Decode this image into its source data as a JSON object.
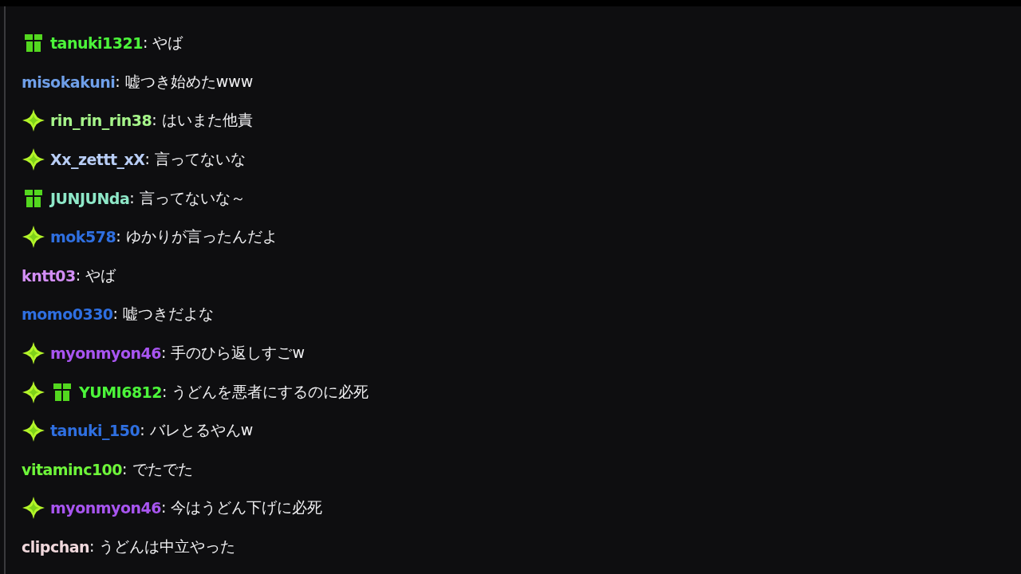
{
  "messages": [
    {
      "badges": [
        {
          "kind": "gift"
        }
      ],
      "user": "tanuki1321",
      "color": "#4cf53a",
      "text": ": やば"
    },
    {
      "user": "misokakuni",
      "color": "#6f9fe8",
      "text": ": 嘘つき始めたwww"
    },
    {
      "badges": [
        {
          "kind": "sparkle"
        }
      ],
      "user": "rin_rin_rin38",
      "color": "#a6f58a",
      "text": ": はいまた他責"
    },
    {
      "badges": [
        {
          "kind": "sparkle"
        }
      ],
      "user": "Xx_zettt_xX",
      "color": "#b8cdf5",
      "text": ": 言ってないな"
    },
    {
      "badges": [
        {
          "kind": "gift"
        }
      ],
      "user": "JUNJUNda",
      "color": "#8ee8c8",
      "text": ": 言ってないな～"
    },
    {
      "badges": [
        {
          "kind": "sparkle"
        }
      ],
      "user": "mok578",
      "color": "#2f6fe0",
      "text": ": ゆかりが言ったんだよ"
    },
    {
      "user": "kntt03",
      "color": "#d28ef5",
      "text": ": やば"
    },
    {
      "user": "momo0330",
      "color": "#2f6fe0",
      "text": ": 嘘つきだよな"
    },
    {
      "badges": [
        {
          "kind": "sparkle"
        }
      ],
      "user": "myonmyon46",
      "color": "#a855f0",
      "text": ": 手のひら返しすごw"
    },
    {
      "badges": [
        {
          "kind": "sparkle"
        },
        {
          "kind": "gift"
        }
      ],
      "user": "YUMI6812",
      "color": "#4cf53a",
      "text": ": うどんを悪者にするのに必死"
    },
    {
      "badges": [
        {
          "kind": "sparkle"
        }
      ],
      "user": "tanuki_150",
      "color": "#2f6fe0",
      "text": ": バレとるやんw"
    },
    {
      "user": "vitaminc100",
      "color": "#6ef53a",
      "text": ": でたでた"
    },
    {
      "badges": [
        {
          "kind": "sparkle"
        }
      ],
      "user": "myonmyon46",
      "color": "#a855f0",
      "text": ": 今はうどん下げに必死"
    },
    {
      "user": "clipchan",
      "color": "#f0d8dc",
      "text": ": うどんは中立やった"
    }
  ]
}
